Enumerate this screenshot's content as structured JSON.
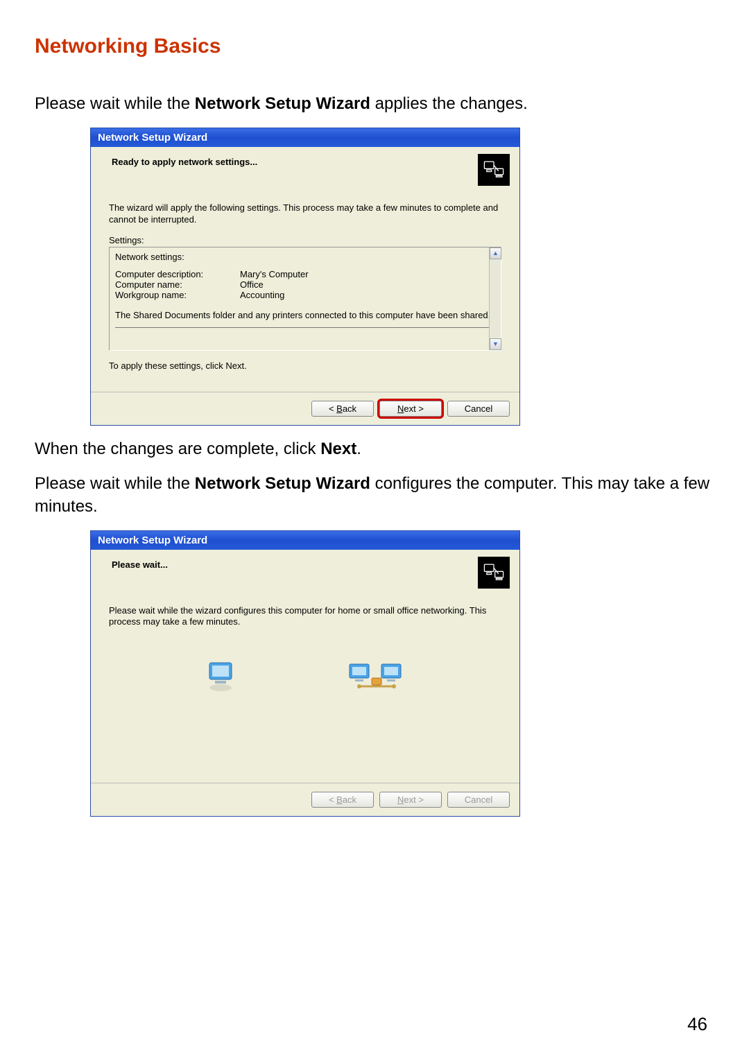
{
  "page": {
    "heading": "Networking Basics",
    "number": "46"
  },
  "intro1_pre": "Please wait while the ",
  "intro1_bold": "Network Setup Wizard",
  "intro1_post": " applies the changes.",
  "intro2_pre": "When the changes are complete, click ",
  "intro2_bold": "Next",
  "intro2_post": ".",
  "intro3_pre": "Please wait while the ",
  "intro3_bold": "Network Setup Wizard",
  "intro3_post": " configures the computer. This may take a few minutes.",
  "wizard1": {
    "title": "Network Setup Wizard",
    "header": "Ready to apply network settings...",
    "explain": "The wizard will apply the following settings. This process may take a few minutes to complete and cannot be interrupted.",
    "settings_label": "Settings:",
    "settings_title": "Network settings:",
    "rows": {
      "desc_label": "Computer description:",
      "desc_value": "Mary's Computer",
      "name_label": "Computer name:",
      "name_value": "Office",
      "wg_label": "Workgroup name:",
      "wg_value": "Accounting"
    },
    "share_text": "The Shared Documents folder and any printers connected to this computer have been shared.",
    "apply_instruction": "To apply these settings, click Next.",
    "buttons": {
      "back": "< Back",
      "next": "Next >",
      "cancel": "Cancel"
    }
  },
  "wizard2": {
    "title": "Network Setup Wizard",
    "header": "Please wait...",
    "explain": "Please wait while the wizard configures this computer for home or small office networking. This process may take a few minutes.",
    "buttons": {
      "back": "< Back",
      "next": "Next >",
      "cancel": "Cancel"
    }
  }
}
